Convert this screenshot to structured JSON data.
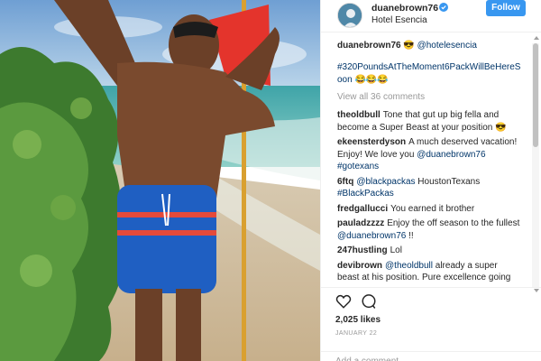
{
  "post": {
    "username": "duanebrown76",
    "location": "Hotel Esencia",
    "follow_label": "Follow",
    "avatar_icon": "profile-photo",
    "verified_icon": "verified-badge-icon",
    "verified_color": "#3897f0",
    "caption_user": "duanebrown76",
    "caption_emoji": "😎",
    "caption_mention": "@hotelesencia",
    "hashtag": "#320PoundsAtTheMoment6PackWillBeHereSoon 😂😂😂",
    "view_all": "View all 36 comments",
    "comments": [
      {
        "user": "theoldbull",
        "text": "Tone that gut up big fella and become a Super Beast at your position 😎",
        "mention": ""
      },
      {
        "user": "ekeensterdyson",
        "text": "A much deserved vacation! Enjoy! We love you ",
        "mention": "@duanebrown76 #gotexans"
      },
      {
        "user": "6ftq",
        "text": "",
        "mention": "@blackpackas",
        "tail": " HoustonTexans ",
        "tail_tag": "#BlackPackas"
      },
      {
        "user": "fredgallucci",
        "text": "You earned it brother",
        "mention": ""
      },
      {
        "user": "pauladzzzz",
        "text": "Enjoy the off season to the fullest ",
        "mention": "@duanebrown76",
        "tail": " !!"
      },
      {
        "user": "247hustling",
        "text": "Lol",
        "mention": ""
      },
      {
        "user": "devibrown",
        "text": "",
        "mention": "@theoldbull",
        "tail": " already a super beast at his position. Pure excellence going"
      }
    ],
    "likes": "2,025 likes",
    "date": "JANUARY 22",
    "add_comment_placeholder": "Add a comment...",
    "like_icon": "heart-icon",
    "comment_icon": "comment-bubble-icon",
    "accent_color": "#3897f0",
    "link_color": "#003569"
  }
}
